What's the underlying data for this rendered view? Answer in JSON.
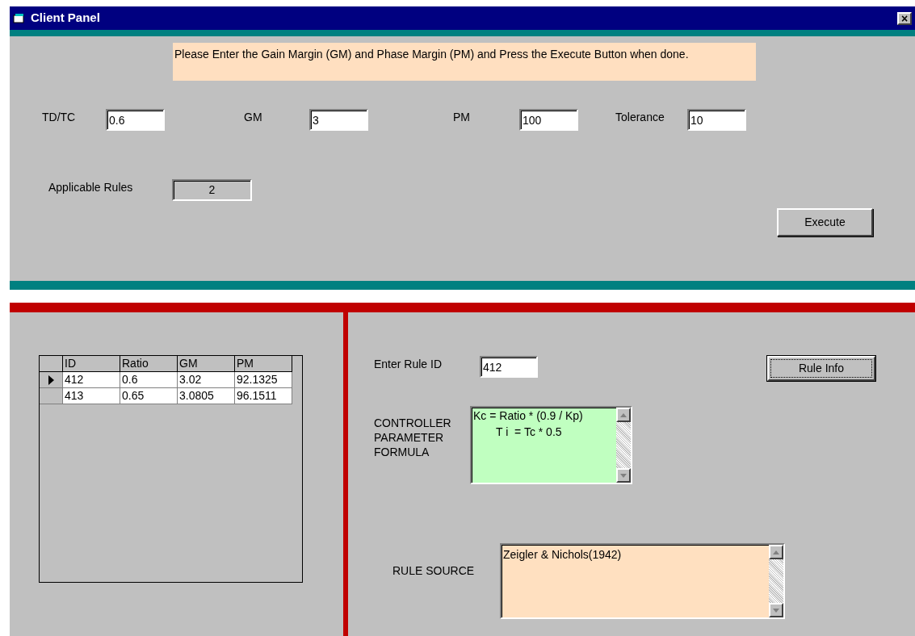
{
  "window": {
    "title": "Client Panel",
    "close": "×"
  },
  "banner": "Please Enter the Gain Margin (GM) and Phase Margin (PM) and Press the Execute Button when done.",
  "fields": [
    {
      "label": "TD/TC",
      "value": "0.6"
    },
    {
      "label": "GM",
      "value": "3"
    },
    {
      "label": "PM",
      "value": "100"
    },
    {
      "label": "Tolerance",
      "value": "10"
    }
  ],
  "applicable_rules": {
    "label": "Applicable Rules",
    "value": "2"
  },
  "execute_button": "Execute",
  "table": {
    "columns": [
      "ID",
      "Ratio",
      "GM",
      "PM"
    ],
    "rows": [
      {
        "cells": [
          "412",
          "0.6",
          "3.02",
          "92.1325"
        ],
        "selected": true
      },
      {
        "cells": [
          "413",
          "0.65",
          "3.0805",
          "96.1511"
        ],
        "selected": false
      }
    ]
  },
  "rule_id": {
    "label": "Enter Rule ID",
    "value": "412"
  },
  "rule_info_button": {
    "label": "Rule Info",
    "focused": true
  },
  "formula": {
    "label": "CONTROLLER PARAMETER FORMULA",
    "lines": [
      "Kc = Ratio * (0.9 / Kp)",
      "T i  = Tc * 0.5"
    ]
  },
  "rule_source": {
    "label": "RULE SOURCE",
    "text": "Zeigler & Nichols(1942)"
  }
}
